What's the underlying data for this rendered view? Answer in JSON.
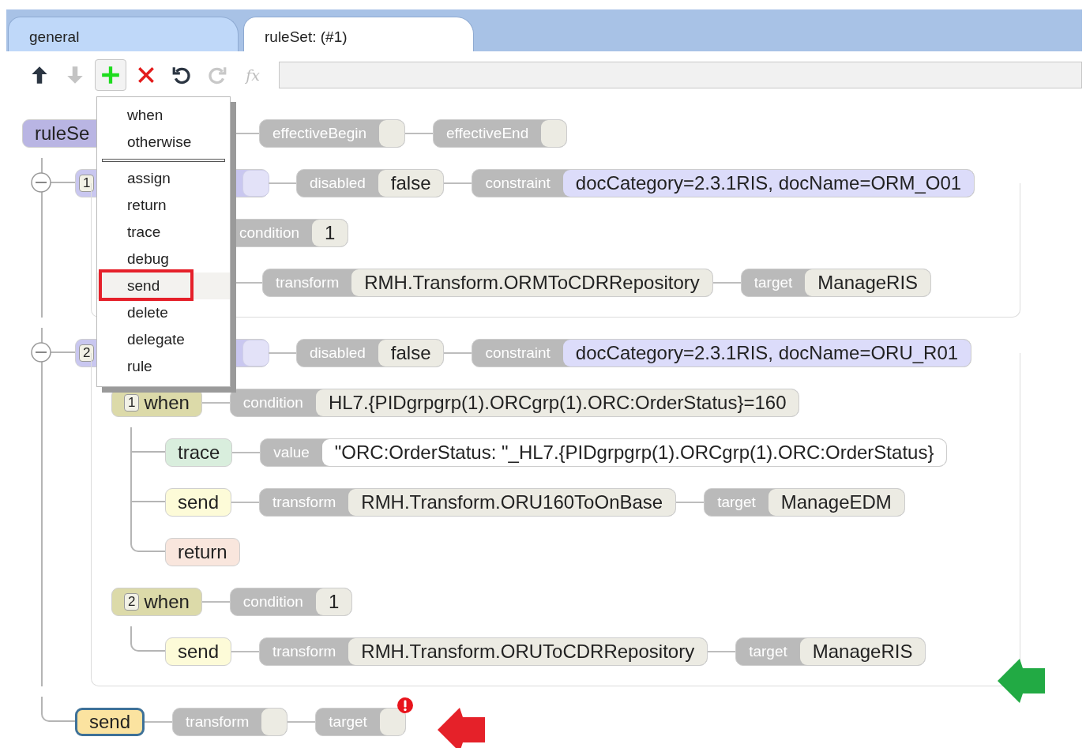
{
  "tabs": [
    {
      "label": "general",
      "selected": false
    },
    {
      "label": "ruleSet: (#1)",
      "selected": true
    }
  ],
  "toolbar": [
    {
      "kind": "up",
      "disabled": false,
      "pressed": false
    },
    {
      "kind": "down",
      "disabled": true,
      "pressed": false
    },
    {
      "kind": "add",
      "disabled": false,
      "pressed": true
    },
    {
      "kind": "delete",
      "disabled": false,
      "pressed": false
    },
    {
      "kind": "undo",
      "disabled": false,
      "pressed": false
    },
    {
      "kind": "redo",
      "disabled": true,
      "pressed": false
    },
    {
      "kind": "function",
      "label": "fx",
      "disabled": true,
      "pressed": false
    }
  ],
  "add_menu": {
    "groups": [
      [
        {
          "label": "when",
          "selected": false
        },
        {
          "label": "otherwise",
          "selected": false
        }
      ],
      [
        {
          "label": "assign",
          "selected": false
        },
        {
          "label": "return",
          "selected": false
        },
        {
          "label": "trace",
          "selected": false
        },
        {
          "label": "debug",
          "selected": false
        },
        {
          "label": "send",
          "selected": true
        },
        {
          "label": "delete",
          "selected": false
        },
        {
          "label": "delegate",
          "selected": false
        },
        {
          "label": "rule",
          "selected": false
        }
      ]
    ]
  },
  "tree": {
    "kind": "ruleSet",
    "label": "ruleSe",
    "selected": false,
    "params": [
      {
        "label": "effectiveBegin",
        "kind": "text"
      },
      {
        "label": "effectiveEnd",
        "kind": "text"
      }
    ],
    "children": [
      {
        "kind": "rule",
        "index": "1",
        "expanded": true,
        "selected": false,
        "params": [
          {
            "label": "disabled",
            "value": "false",
            "kind": "text"
          },
          {
            "label": "constraint",
            "value": "docCategory=2.3.1RIS, docName=ORM_O01",
            "kind": "constraint"
          }
        ],
        "children": [
          {
            "kind": "when",
            "params": [
              {
                "label": "condition",
                "value": "1",
                "kind": "text"
              }
            ],
            "children": [
              {
                "kind": "send",
                "params": [
                  {
                    "label": "transform",
                    "value": "RMH.Transform.ORMToCDRRepository",
                    "kind": "text"
                  },
                  {
                    "label": "target",
                    "value": "ManageRIS",
                    "kind": "text"
                  }
                ]
              }
            ]
          }
        ]
      },
      {
        "kind": "rule",
        "index": "2",
        "expanded": true,
        "selected": false,
        "params": [
          {
            "label": "disabled",
            "value": "false",
            "kind": "text"
          },
          {
            "label": "constraint",
            "value": "docCategory=2.3.1RIS, docName=ORU_R01",
            "kind": "constraint"
          }
        ],
        "marker": {
          "color": "#22aa44"
        },
        "children": [
          {
            "kind": "when",
            "index": "1",
            "label": "when",
            "selected": false,
            "params": [
              {
                "label": "condition",
                "value": "HL7.{PIDgrpgrp(1).ORCgrp(1).ORC:OrderStatus}=160",
                "kind": "text"
              }
            ],
            "children": [
              {
                "kind": "trace",
                "label": "trace",
                "selected": false,
                "params": [
                  {
                    "label": "value",
                    "value": "\"ORC:OrderStatus: \"_HL7.{PIDgrpgrp(1).ORCgrp(1).ORC:OrderStatus}",
                    "kind": "string"
                  }
                ]
              },
              {
                "kind": "send",
                "label": "send",
                "selected": false,
                "params": [
                  {
                    "label": "transform",
                    "value": "RMH.Transform.ORU160ToOnBase",
                    "kind": "text"
                  },
                  {
                    "label": "target",
                    "value": "ManageEDM",
                    "kind": "text"
                  }
                ]
              },
              {
                "kind": "return",
                "label": "return",
                "selected": false
              }
            ]
          },
          {
            "kind": "when",
            "index": "2",
            "label": "when",
            "selected": false,
            "params": [
              {
                "label": "condition",
                "value": "1",
                "kind": "text"
              }
            ],
            "children": [
              {
                "kind": "send",
                "label": "send",
                "selected": false,
                "params": [
                  {
                    "label": "transform",
                    "value": "RMH.Transform.ORUToCDRRepository",
                    "kind": "text"
                  },
                  {
                    "label": "target",
                    "value": "ManageRIS",
                    "kind": "text"
                  }
                ]
              }
            ]
          }
        ]
      },
      {
        "kind": "send",
        "label": "send",
        "selected": true,
        "params": [
          {
            "label": "transform",
            "kind": "text",
            "error": false
          },
          {
            "label": "target",
            "kind": "text",
            "error": true
          }
        ],
        "marker": {
          "color": "#e52129"
        }
      }
    ]
  }
}
